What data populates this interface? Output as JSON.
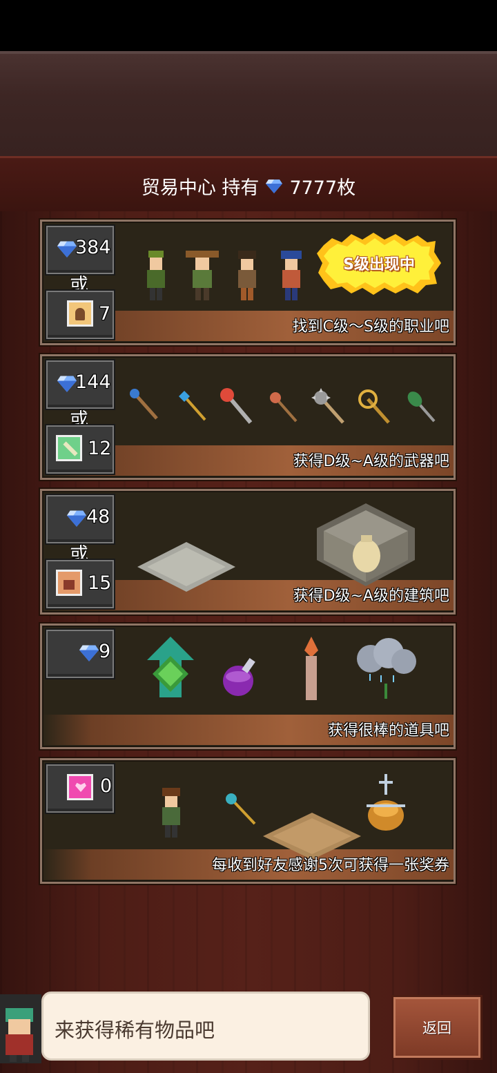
{
  "header": {
    "title": "贸易中心 持有",
    "gem_count": "7777枚",
    "gem_icon": "diamond-icon"
  },
  "cards": [
    {
      "price_gems": "384",
      "or": "或",
      "price_tickets": "7",
      "ticket_icon": "job-ticket-icon",
      "badge": "S级出现中",
      "description": "找到C级～S级的职业吧"
    },
    {
      "price_gems": "144",
      "or": "或",
      "price_tickets": "12",
      "ticket_icon": "weapon-ticket-icon",
      "description": "获得D级~A级的武器吧"
    },
    {
      "price_gems": "48",
      "or": "或",
      "price_tickets": "15",
      "ticket_icon": "building-ticket-icon",
      "description": "获得D级~A级的建筑吧"
    },
    {
      "price_gems": "9",
      "description": "获得很棒的道具吧"
    },
    {
      "price_hearts": "0",
      "heart_icon": "heart-ticket-icon",
      "description": "每收到好友感谢5次可获得一张奖券"
    }
  ],
  "footer": {
    "message": "来获得稀有物品吧",
    "back_label": "返回"
  },
  "colors": {
    "gem": "#6fa7ff",
    "strip": "#a0603a",
    "badge": "#ffe22a"
  }
}
